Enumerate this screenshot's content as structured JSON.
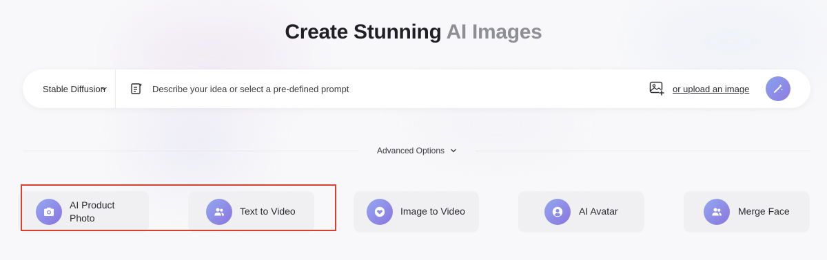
{
  "header": {
    "title_main": "Create Stunning",
    "title_accent": "AI Images"
  },
  "prompt_bar": {
    "model_label": "Stable Diffusion",
    "model_chevron_icon": "chevron-down-icon",
    "prompt_icon": "prompt-list-icon",
    "prompt_placeholder": "Describe your idea or select a pre-defined prompt",
    "upload_icon": "image-add-icon",
    "upload_label": "or upload an image",
    "generate_icon": "magic-wand-icon"
  },
  "advanced": {
    "label": "Advanced Options",
    "icon": "chevron-down-icon"
  },
  "tools": [
    {
      "label": "AI Product Photo",
      "icon": "camera-icon"
    },
    {
      "label": "Text to Video",
      "icon": "users-icon"
    },
    {
      "label": "Image to Video",
      "icon": "heart-icon"
    },
    {
      "label": "AI Avatar",
      "icon": "user-icon"
    },
    {
      "label": "Merge Face",
      "icon": "users-icon"
    }
  ],
  "colors": {
    "accent_gradient_start": "#93a8f0",
    "accent_gradient_end": "#8a74de",
    "highlight": "#d9412f",
    "title_accent": "#8e8e95"
  }
}
